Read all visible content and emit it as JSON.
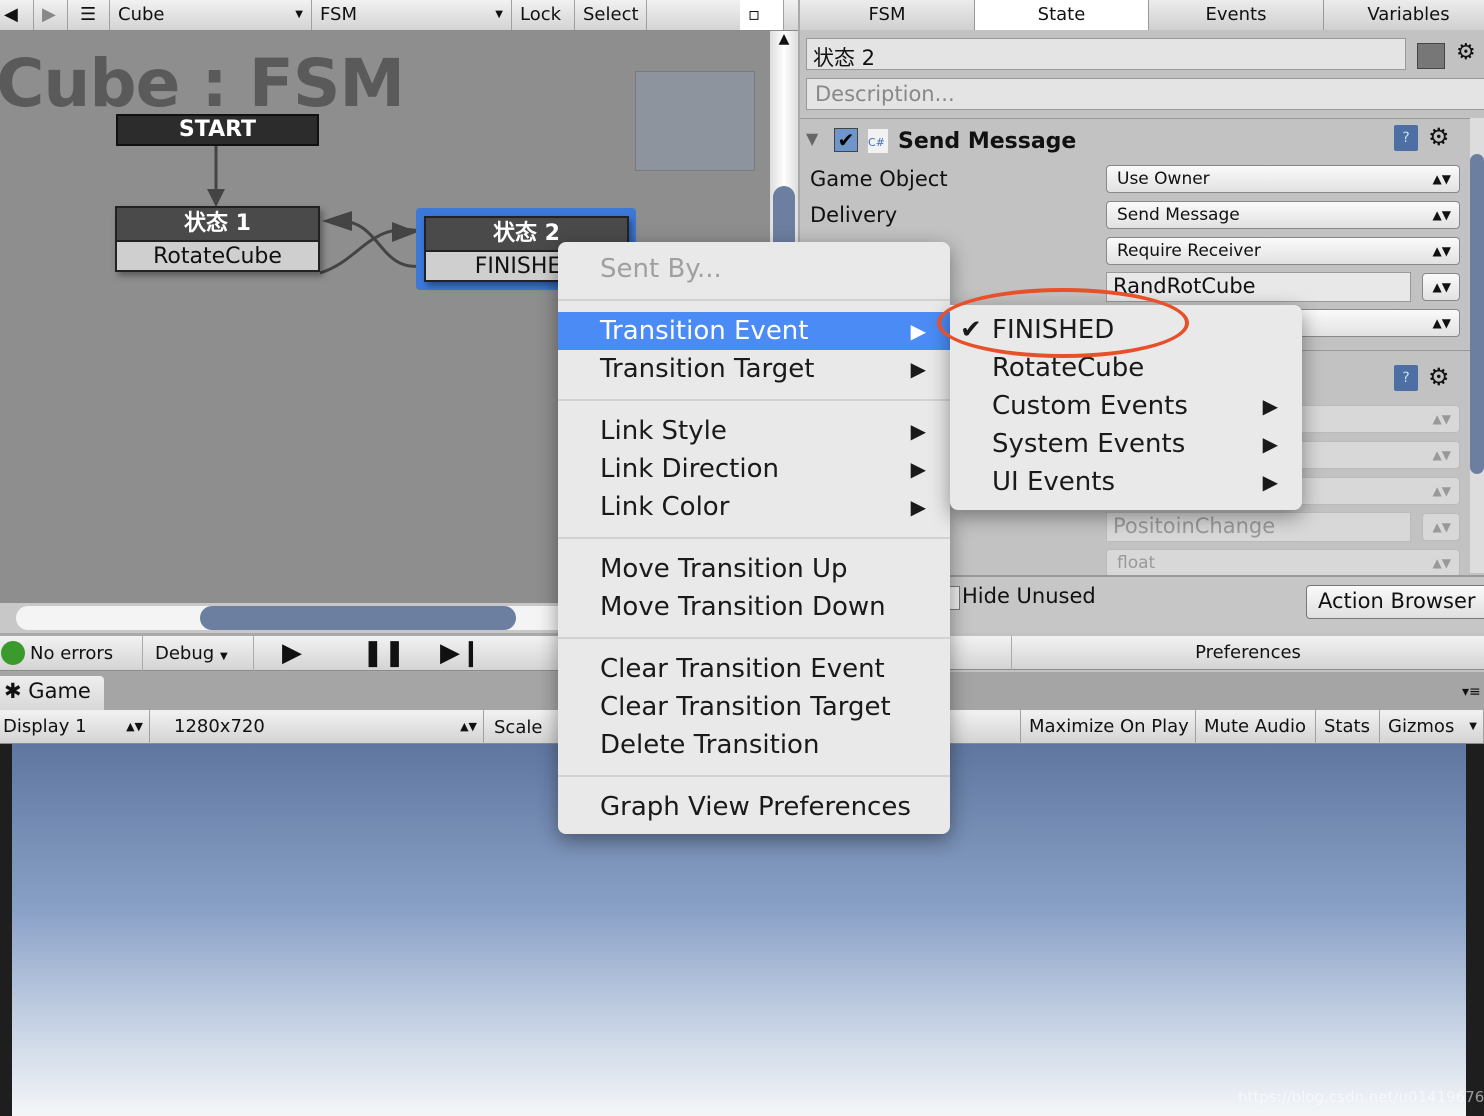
{
  "fsm_toolbar": {
    "object": "Cube",
    "fsm": "FSM",
    "lock": "Lock",
    "select": "Select"
  },
  "graph": {
    "title": "Cube : FSM",
    "start": "START",
    "states": [
      {
        "name": "状态 1",
        "action": "RotateCube"
      },
      {
        "name": "状态 2",
        "event": "FINISHED"
      }
    ]
  },
  "inspector": {
    "tabs": [
      "FSM",
      "State",
      "Events",
      "Variables"
    ],
    "active_tab": "State",
    "state_name": "状态 2",
    "description_placeholder": "Description...",
    "action": {
      "title": "Send Message",
      "enabled": true,
      "game_object_label": "Game Object",
      "game_object": "Use Owner",
      "delivery_label": "Delivery",
      "delivery": "Send Message",
      "options": "Require Receiver",
      "method_name": "RandRotCube"
    },
    "action2": {
      "param_name": "PositoinChange",
      "param_type": "float"
    },
    "hide_unused": "Hide Unused",
    "action_browser": "Action Browser",
    "preferences": "Preferences"
  },
  "play_toolbar": {
    "status": "No errors",
    "status_color": "#3a9a2e",
    "debug": "Debug"
  },
  "game": {
    "tab": "Game",
    "display": "Display 1",
    "resolution": "1280x720",
    "scale": "Scale",
    "buttons": [
      "Maximize On Play",
      "Mute Audio",
      "Stats",
      "Gizmos"
    ]
  },
  "context_menu": {
    "header": "Sent By...",
    "groups": [
      [
        "Transition Event",
        "Transition Target"
      ],
      [
        "Link Style",
        "Link Direction",
        "Link Color"
      ],
      [
        "Move Transition Up",
        "Move Transition Down"
      ],
      [
        "Clear Transition Event",
        "Clear Transition Target",
        "Delete Transition"
      ],
      [
        "Graph View Preferences"
      ]
    ],
    "highlighted": "Transition Event"
  },
  "submenu": {
    "items": [
      "FINISHED",
      "RotateCube",
      "Custom Events",
      "System Events",
      "UI Events"
    ],
    "checked": "FINISHED"
  },
  "highlight_color": "#e8502a",
  "watermark": "https://blog.csdn.net/u014196765"
}
